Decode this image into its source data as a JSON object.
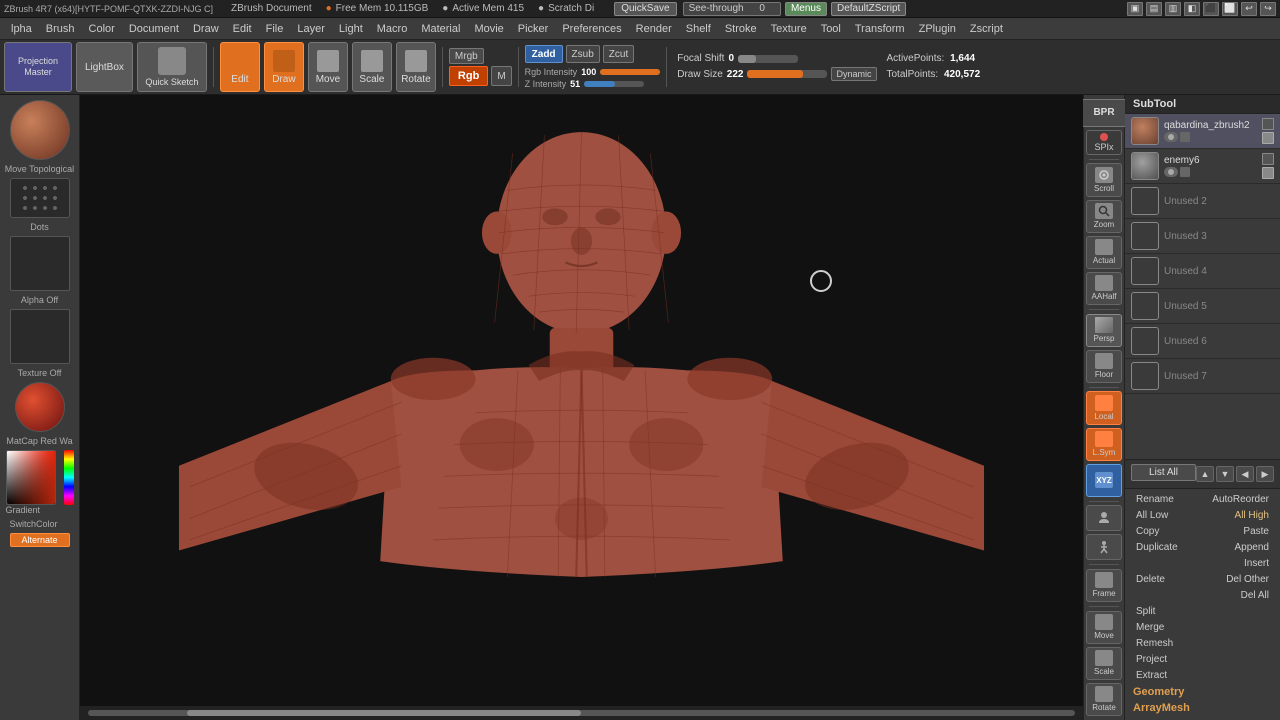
{
  "topbar": {
    "title": "ZBrush 4R7 (x64)[HYTF-POMF-QTXK-ZZDI-NJG C]",
    "document_label": "ZBrush Document",
    "free_mem": "Free Mem 10.115GB",
    "active_mem": "Active Mem 415",
    "scratch": "Scratch Di",
    "quicksave_label": "QuickSave",
    "seethrough_label": "See-through",
    "seethrough_val": "0",
    "menus_label": "Menus",
    "defaultz_label": "DefaultZScript"
  },
  "menubar": {
    "items": [
      "lpha",
      "Brush",
      "Color",
      "Document",
      "Draw",
      "Edit",
      "File",
      "Layer",
      "Light",
      "Macro",
      "Material",
      "Movie",
      "Picker",
      "Preferences",
      "Render",
      "Shelf",
      "Stroke",
      "Texture",
      "Tool",
      "Transform",
      "ZPlugin",
      "Zscript"
    ]
  },
  "toolbar": {
    "projection_label": "Projection",
    "master_label": "Master",
    "lightbox_label": "LightBox",
    "quick_label": "Quick",
    "sketch_label": "Sketch",
    "edit_label": "Edit",
    "draw_label": "Draw",
    "move_label": "Move",
    "scale_label": "Scale",
    "rotate_label": "Rotate",
    "mrgb_label": "Mrgb",
    "rgb_label": "Rgb",
    "m_label": "M",
    "zadd_label": "Zadd",
    "zsub_label": "Zsub",
    "zcut_label": "Zcut",
    "focal_label": "Focal Shift",
    "focal_val": "0",
    "active_points_label": "ActivePoints:",
    "active_points_val": "1,644",
    "total_points_label": "TotalPoints:",
    "total_points_val": "420,572",
    "rgb_intensity_label": "Rgb Intensity",
    "rgb_intensity_val": "100",
    "z_intensity_label": "Z Intensity",
    "z_intensity_val": "51",
    "draw_size_label": "Draw Size",
    "draw_size_val": "222",
    "dynamic_label": "Dynamic"
  },
  "left_panel": {
    "move_topo_label": "Move Topological",
    "dots_label": "Dots",
    "alpha_label": "Alpha Off",
    "texture_label": "Texture Off",
    "matcap_label": "MatCap Red Wa",
    "gradient_label": "Gradient",
    "switch_label": "SwitchColor",
    "alternate_label": "Alternate"
  },
  "right_tools": {
    "buttons": [
      {
        "label": "BPR",
        "type": "bpr"
      },
      {
        "label": "SPIx",
        "type": "spix"
      },
      {
        "label": "Scroll",
        "type": "normal"
      },
      {
        "label": "Zoom",
        "type": "normal"
      },
      {
        "label": "Actual",
        "type": "normal"
      },
      {
        "label": "AAHalf",
        "type": "normal"
      },
      {
        "label": "Persp",
        "type": "persp"
      },
      {
        "label": "Floor",
        "type": "normal"
      },
      {
        "label": "Local",
        "type": "active-orange"
      },
      {
        "label": "L.Sym",
        "type": "active-orange"
      },
      {
        "label": "XYZ",
        "type": "active-blue"
      },
      {
        "label": "",
        "type": "icon"
      },
      {
        "label": "",
        "type": "icon"
      },
      {
        "label": "Frame",
        "type": "normal"
      },
      {
        "label": "Move",
        "type": "normal"
      },
      {
        "label": "Scale",
        "type": "normal"
      },
      {
        "label": "Rotate",
        "type": "normal"
      }
    ]
  },
  "subtool": {
    "header": "SubTool",
    "items": [
      {
        "name": "qabardina_zbrush2",
        "type": "head",
        "active": true
      },
      {
        "name": "enemy6",
        "type": "enemy",
        "active": false
      },
      {
        "name": "Unused 2",
        "type": "unused"
      },
      {
        "name": "Unused 3",
        "type": "unused"
      },
      {
        "name": "Unused 4",
        "type": "unused"
      },
      {
        "name": "Unused 5",
        "type": "unused"
      },
      {
        "name": "Unused 6",
        "type": "unused"
      },
      {
        "name": "Unused 7",
        "type": "unused"
      }
    ],
    "list_all_label": "List All",
    "rename_label": "Rename",
    "auto_reorder_label": "AutoReorder",
    "all_low_label": "All Low",
    "all_high_label": "All High",
    "copy_label": "Copy",
    "paste_label": "Paste",
    "duplicate_label": "Duplicate",
    "append_label": "Append",
    "insert_label": "Insert",
    "delete_label": "Delete",
    "del_other_label": "Del Other",
    "del_all_label": "Del All",
    "split_label": "Split",
    "merge_label": "Merge",
    "remesh_label": "Remesh",
    "project_label": "Project",
    "extract_label": "Extract",
    "geometry_label": "Geometry",
    "arraymesh_label": "ArrayMesh"
  }
}
